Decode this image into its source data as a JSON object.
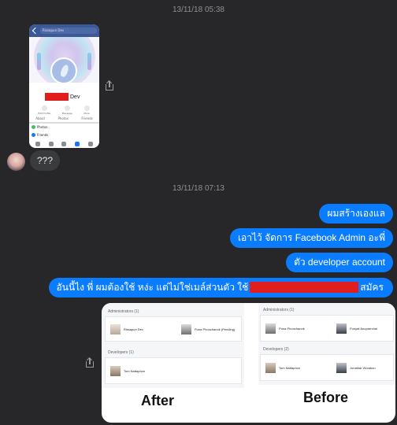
{
  "timestamps": [
    "13/11/18 05:38",
    "13/11/18 07:13"
  ],
  "received_screenshot": {
    "search_text": "Rissapun Dev",
    "profile_name_suffix": "Dev",
    "actions": [
      "Edit Profile",
      "Message",
      "More"
    ],
    "tabs": [
      "About",
      "Photos",
      "Friends"
    ],
    "rows": [
      "Photos",
      "Friends"
    ]
  },
  "received_message": "???",
  "sent_messages": [
    "ผมสร้างเองแล",
    "เอาไว้ จัดการ Facebook Admin อะพี่",
    "ตัว developer account"
  ],
  "long_message": {
    "before_redaction": "อันนี้ไง พี่ ผมต้องใช้ หง่ะ แต่ไม่ใช่เมล์ส่วนตัว ใช้",
    "after_redaction": "สมัคร"
  },
  "comparison": {
    "after": {
      "caption": "After",
      "admins_label": "Administrators (1)",
      "admins": [
        "Rissapun Dev",
        "Puna Phonchanok (Pending)"
      ],
      "devs_label": "Developers (1)",
      "devs": [
        "Tom Nattaphon"
      ]
    },
    "before": {
      "caption": "Before",
      "admins_label": "Administrators (1)",
      "admins": [
        "Puna Phonchanok",
        "Punyat Anuparrchai"
      ],
      "devs_label": "Developers (2)",
      "devs": [
        "Tom Nattaphon",
        "Jonathar Worakon"
      ]
    }
  }
}
